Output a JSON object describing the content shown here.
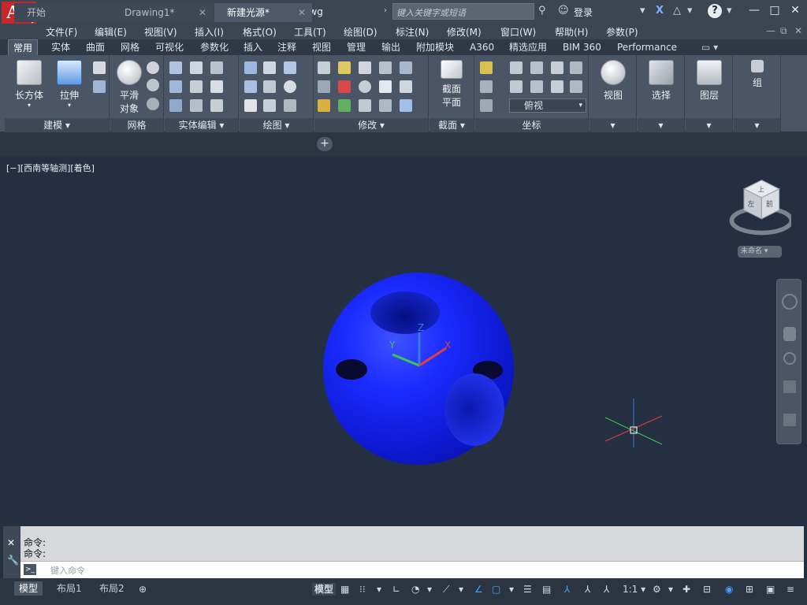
{
  "app": {
    "logo_letter": "A",
    "title": "新建光源.dwg"
  },
  "search": {
    "placeholder": "键入关键字或短语"
  },
  "titlebar": {
    "login_label": "登录"
  },
  "menu": [
    "文件(F)",
    "编辑(E)",
    "视图(V)",
    "插入(I)",
    "格式(O)",
    "工具(T)",
    "绘图(D)",
    "标注(N)",
    "修改(M)",
    "窗口(W)",
    "帮助(H)",
    "参数(P)"
  ],
  "ribbon_tabs": [
    "常用",
    "实体",
    "曲面",
    "网格",
    "可视化",
    "参数化",
    "插入",
    "注释",
    "视图",
    "管理",
    "输出",
    "附加模块",
    "A360",
    "精选应用",
    "BIM 360",
    "Performance"
  ],
  "ribbon_active_tab": "常用",
  "ribbon": {
    "buttons": {
      "box": "长方体",
      "extrude": "拉伸",
      "smooth_line1": "平滑",
      "smooth_line2": "对象",
      "section_line1": "截面",
      "section_line2": "平面",
      "view": "视图",
      "select": "选择",
      "layer": "图层",
      "group": "组"
    },
    "view_combo": "俯视",
    "panels": {
      "modeling": "建模 ▾",
      "mesh": "网格",
      "solid_edit": "实体编辑 ▾",
      "draw": "绘图 ▾",
      "modify": "修改 ▾",
      "section": "截面 ▾",
      "coordinates": "坐标"
    }
  },
  "doc_tabs": [
    "开始",
    "Drawing1*",
    "新建光源*"
  ],
  "doc_tab_active": "新建光源*",
  "viewport": {
    "label": "[−][西南等轴测][着色]",
    "ucs_x": "X",
    "ucs_y": "Y",
    "ucs_z": "Z",
    "viewcube_top": "上",
    "viewcube_front": "前",
    "viewcube_left": "左",
    "unnamed": "未命名 ▾"
  },
  "command": {
    "line1": "命令:",
    "line2": "命令:",
    "placeholder": "键入命令"
  },
  "layout_tabs": [
    "模型",
    "布局1",
    "布局2"
  ],
  "status": {
    "model_label": "模型",
    "scale": "1:1 ▾"
  },
  "colors": {
    "accent_red": "#c8282a",
    "sphere_blue": "#1a2bff",
    "background": "#243040"
  }
}
